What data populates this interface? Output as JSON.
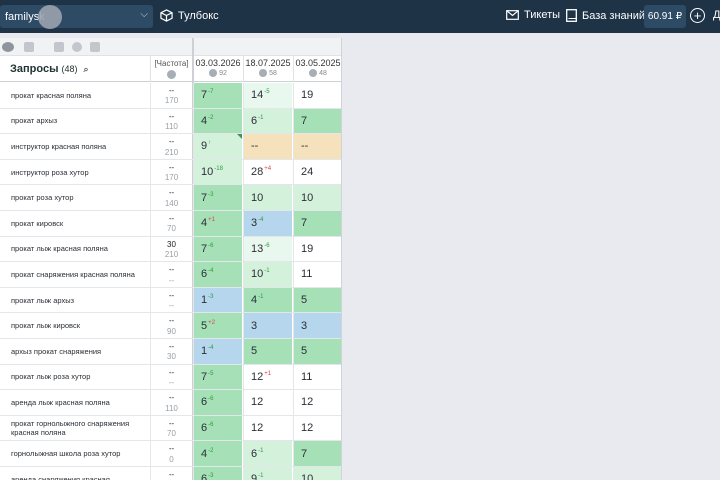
{
  "topbar": {
    "project": "familysk",
    "toolbox": "Тулбокс",
    "tickets": "Тикеты",
    "kb": "База знаний",
    "balance": "60.91 ₽",
    "cut_letter": "Д"
  },
  "table": {
    "header": {
      "queries": "Запросы",
      "count": "(48)",
      "freq": "[Частота]",
      "dates": [
        {
          "date": "03.03.2026",
          "sub": "92"
        },
        {
          "date": "18.07.2025",
          "sub": "58"
        },
        {
          "date": "03.05.2025",
          "sub": "48"
        }
      ]
    },
    "rows": [
      {
        "q": "прокат красная поляна",
        "f1": "--",
        "f2": "170",
        "c": [
          {
            "v": "7",
            "d": "-7",
            "dir": "up",
            "bg": "green"
          },
          {
            "v": "14",
            "d": "-5",
            "dir": "up",
            "bg": "vlgreen"
          },
          {
            "v": "19",
            "d": "",
            "dir": "",
            "bg": "white"
          }
        ]
      },
      {
        "q": "прокат архыз",
        "f1": "--",
        "f2": "110",
        "c": [
          {
            "v": "4",
            "d": "-2",
            "dir": "up",
            "bg": "green"
          },
          {
            "v": "6",
            "d": "-1",
            "dir": "up",
            "bg": "lgreen"
          },
          {
            "v": "7",
            "d": "",
            "dir": "",
            "bg": "green"
          }
        ]
      },
      {
        "q": "инструктор красная поляна",
        "f1": "--",
        "f2": "210",
        "c": [
          {
            "v": "9",
            "d": "↑",
            "dir": "up",
            "bg": "lgreen",
            "tri": true
          },
          {
            "v": "--",
            "d": "",
            "dir": "",
            "bg": "orange"
          },
          {
            "v": "--",
            "d": "",
            "dir": "",
            "bg": "orange"
          }
        ]
      },
      {
        "q": "инструктор роза хутор",
        "f1": "--",
        "f2": "170",
        "c": [
          {
            "v": "10",
            "d": "-18",
            "dir": "up",
            "bg": "lgreen"
          },
          {
            "v": "28",
            "d": "+4",
            "dir": "dn",
            "bg": "white"
          },
          {
            "v": "24",
            "d": "",
            "dir": "",
            "bg": "white"
          }
        ]
      },
      {
        "q": "прокат роза хутор",
        "f1": "--",
        "f2": "140",
        "c": [
          {
            "v": "7",
            "d": "-3",
            "dir": "up",
            "bg": "green"
          },
          {
            "v": "10",
            "d": "",
            "dir": "",
            "bg": "lgreen"
          },
          {
            "v": "10",
            "d": "",
            "dir": "",
            "bg": "lgreen"
          }
        ]
      },
      {
        "q": "прокат кировск",
        "f1": "--",
        "f2": "70",
        "c": [
          {
            "v": "4",
            "d": "+1",
            "dir": "dn",
            "bg": "green"
          },
          {
            "v": "3",
            "d": "-4",
            "dir": "up",
            "bg": "blue"
          },
          {
            "v": "7",
            "d": "",
            "dir": "",
            "bg": "green"
          }
        ]
      },
      {
        "q": "прокат лыж красная поляна",
        "f1": "30",
        "f2": "210",
        "c": [
          {
            "v": "7",
            "d": "-6",
            "dir": "up",
            "bg": "green"
          },
          {
            "v": "13",
            "d": "-6",
            "dir": "up",
            "bg": "vlgreen"
          },
          {
            "v": "19",
            "d": "",
            "dir": "",
            "bg": "white"
          }
        ]
      },
      {
        "q": "прокат снаряжения красная поляна",
        "f1": "--",
        "f2": "--",
        "c": [
          {
            "v": "6",
            "d": "-4",
            "dir": "up",
            "bg": "green"
          },
          {
            "v": "10",
            "d": "-1",
            "dir": "up",
            "bg": "lgreen"
          },
          {
            "v": "11",
            "d": "",
            "dir": "",
            "bg": "white"
          }
        ]
      },
      {
        "q": "прокат лыж архыз",
        "f1": "--",
        "f2": "--",
        "c": [
          {
            "v": "1",
            "d": "-3",
            "dir": "up",
            "bg": "blue"
          },
          {
            "v": "4",
            "d": "-1",
            "dir": "up",
            "bg": "green"
          },
          {
            "v": "5",
            "d": "",
            "dir": "",
            "bg": "green"
          }
        ]
      },
      {
        "q": "прокат лыж кировск",
        "f1": "--",
        "f2": "90",
        "c": [
          {
            "v": "5",
            "d": "+2",
            "dir": "dn",
            "bg": "green"
          },
          {
            "v": "3",
            "d": "",
            "dir": "",
            "bg": "blue"
          },
          {
            "v": "3",
            "d": "",
            "dir": "",
            "bg": "blue"
          }
        ]
      },
      {
        "q": "архыз прокат снаряжения",
        "f1": "--",
        "f2": "30",
        "c": [
          {
            "v": "1",
            "d": "-4",
            "dir": "up",
            "bg": "blue"
          },
          {
            "v": "5",
            "d": "",
            "dir": "",
            "bg": "green"
          },
          {
            "v": "5",
            "d": "",
            "dir": "",
            "bg": "green"
          }
        ]
      },
      {
        "q": "прокат лыж роза хутор",
        "f1": "--",
        "f2": "--",
        "c": [
          {
            "v": "7",
            "d": "-5",
            "dir": "up",
            "bg": "green"
          },
          {
            "v": "12",
            "d": "+1",
            "dir": "dn",
            "bg": "white"
          },
          {
            "v": "11",
            "d": "",
            "dir": "",
            "bg": "white"
          }
        ]
      },
      {
        "q": "аренда лыж красная поляна",
        "f1": "--",
        "f2": "110",
        "c": [
          {
            "v": "6",
            "d": "-6",
            "dir": "up",
            "bg": "green"
          },
          {
            "v": "12",
            "d": "",
            "dir": "",
            "bg": "white"
          },
          {
            "v": "12",
            "d": "",
            "dir": "",
            "bg": "white"
          }
        ]
      },
      {
        "q": "прокат горнолыжного снаряжения красная поляна",
        "f1": "--",
        "f2": "70",
        "c": [
          {
            "v": "6",
            "d": "-6",
            "dir": "up",
            "bg": "green"
          },
          {
            "v": "12",
            "d": "",
            "dir": "",
            "bg": "white"
          },
          {
            "v": "12",
            "d": "",
            "dir": "",
            "bg": "white"
          }
        ]
      },
      {
        "q": "горнолыжная школа роза хутор",
        "f1": "--",
        "f2": "0",
        "c": [
          {
            "v": "4",
            "d": "-2",
            "dir": "up",
            "bg": "green"
          },
          {
            "v": "6",
            "d": "-1",
            "dir": "up",
            "bg": "lgreen"
          },
          {
            "v": "7",
            "d": "",
            "dir": "",
            "bg": "green"
          }
        ]
      },
      {
        "q": "аренда снаряжения красная",
        "f1": "--",
        "f2": "--",
        "c": [
          {
            "v": "6",
            "d": "-3",
            "dir": "up",
            "bg": "green"
          },
          {
            "v": "9",
            "d": "-1",
            "dir": "up",
            "bg": "lgreen"
          },
          {
            "v": "10",
            "d": "",
            "dir": "",
            "bg": "lgreen"
          }
        ]
      }
    ]
  }
}
